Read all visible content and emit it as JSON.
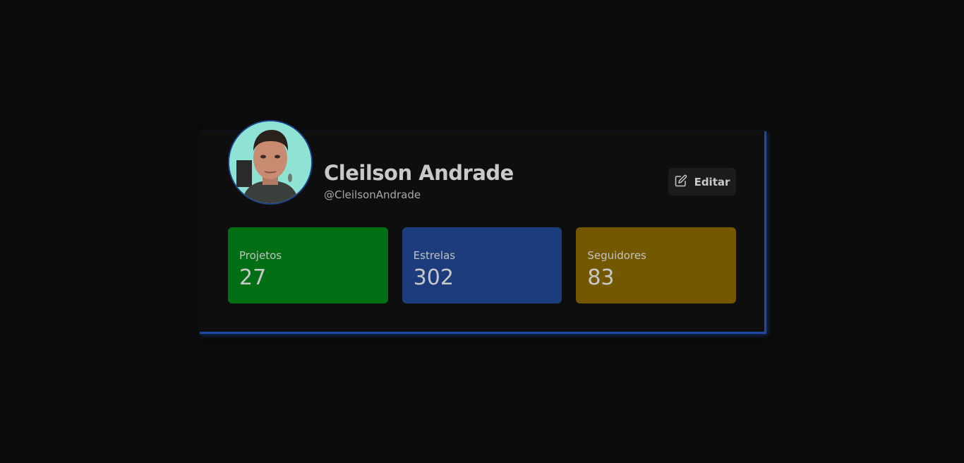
{
  "profile": {
    "name": "Cleilson Andrade",
    "handle": "@CleilsonAndrade"
  },
  "edit_button": {
    "label": "Editar",
    "icon": "edit-icon"
  },
  "stats": [
    {
      "label": "Projetos",
      "value": "27",
      "color": "#026f14"
    },
    {
      "label": "Estrelas",
      "value": "302",
      "color": "#1c3c7c"
    },
    {
      "label": "Seguidores",
      "value": "83",
      "color": "#745800"
    }
  ],
  "colors": {
    "background": "#0b0b0b",
    "card": "#0e0e0e",
    "accent": "#1e4aa3"
  }
}
